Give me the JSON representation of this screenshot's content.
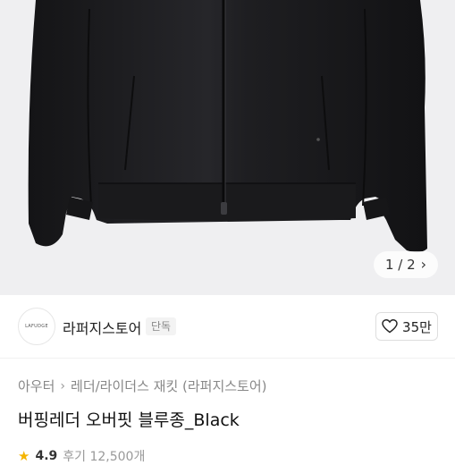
{
  "hero": {
    "pager": {
      "current": "1 / 2",
      "next_icon": "chevron-right"
    }
  },
  "store": {
    "logo_text": "LAFUDGE",
    "name": "라퍼지스토어",
    "badge": "단독",
    "likes": "35만"
  },
  "breadcrumb": {
    "level1": "아우터",
    "level2": "레더/라이더스 재킷 (라퍼지스토어)"
  },
  "product": {
    "title": "버핑레더 오버핏 블루종_Black"
  },
  "rating": {
    "value": "4.9",
    "reviews": "후기 12,500개"
  },
  "colors": {
    "star": "#f5b400",
    "hero_bg": "#efeff1",
    "jacket": "#1b1b1d"
  }
}
